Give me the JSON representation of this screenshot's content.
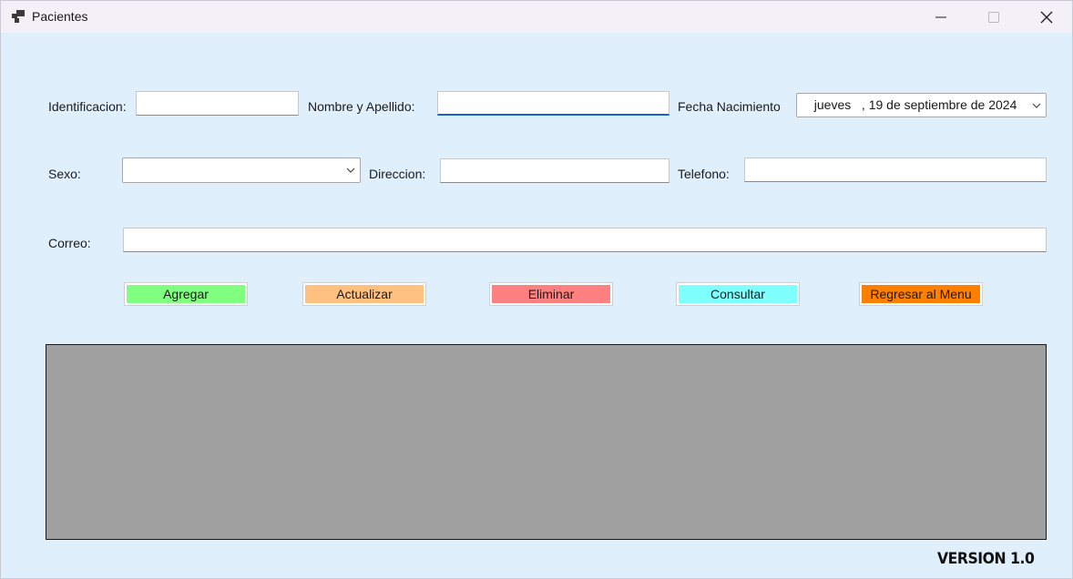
{
  "window": {
    "title": "Pacientes"
  },
  "form": {
    "identificacion_label": "Identificacion:",
    "identificacion_value": "",
    "nombre_label": "Nombre y Apellido:",
    "nombre_value": "",
    "fecha_label": "Fecha Nacimiento",
    "fecha_value": "  jueves   , 19 de septiembre de 2024",
    "sexo_label": "Sexo:",
    "sexo_value": "",
    "direccion_label": "Direccion:",
    "direccion_value": "",
    "telefono_label": "Telefono:",
    "telefono_value": "",
    "correo_label": "Correo:",
    "correo_value": ""
  },
  "buttons": {
    "agregar": "Agregar",
    "actualizar": "Actualizar",
    "eliminar": "Eliminar",
    "consultar": "Consultar",
    "regresar": "Regresar al Menu"
  },
  "colors": {
    "agregar": "#80ff80",
    "actualizar": "#ffc080",
    "eliminar": "#ff8080",
    "consultar": "#80ffff",
    "regresar": "#ff8000",
    "grid": "#a0a0a0",
    "background": "#dfeffc"
  },
  "footer": {
    "version": "VERSION 1.0"
  },
  "icons": {
    "app": "app-windows-icon",
    "minimize": "minimize-icon",
    "maximize": "maximize-icon",
    "close": "close-icon",
    "dropdown": "chevron-down-icon"
  }
}
